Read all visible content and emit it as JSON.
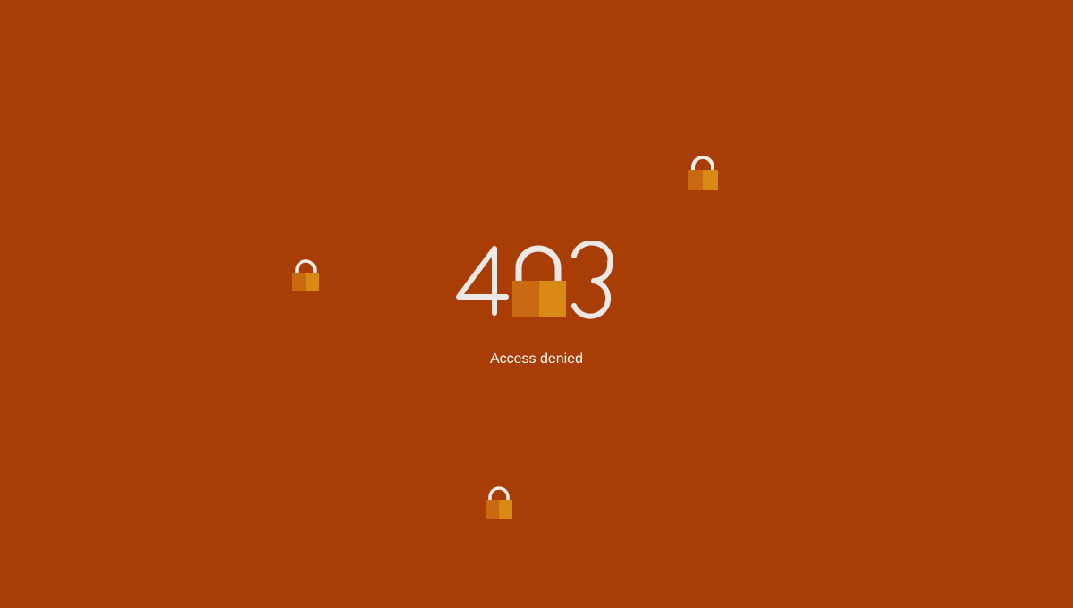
{
  "error": {
    "code": "403",
    "message": "Access denied"
  },
  "colors": {
    "background": "#a83e05",
    "lock_body_dark": "#c96a12",
    "lock_body_light": "#d98a14",
    "shackle": "#f0ece8",
    "digits": "#ece8e6"
  },
  "icons": [
    "padlock-icon"
  ]
}
